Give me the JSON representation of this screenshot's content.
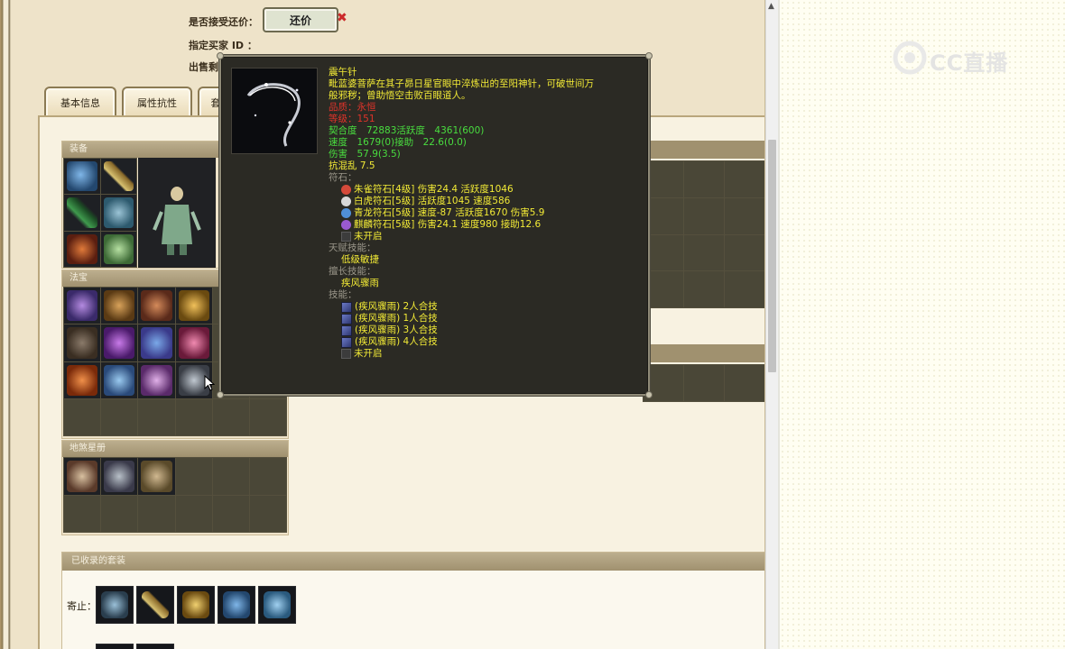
{
  "form": {
    "accept_counter_label": "是否接受还价：",
    "counter_button": "还价",
    "buyer_id_label": "指定买家 ID ：",
    "sale_label_partial": "出售剩"
  },
  "tabs": [
    {
      "label": "基本信息"
    },
    {
      "label": "属性抗性"
    },
    {
      "label": "套"
    }
  ],
  "sections": {
    "equipment": "装备",
    "treasure": "法宝",
    "starbook": "地煞星册",
    "collected_sets": "已收录的套装",
    "set_row_label": "寄止："
  },
  "watermark": "CC直播",
  "tooltip": {
    "name": "震午针",
    "desc_line1": "毗蓝婆菩萨在其子昴日星官眼中淬炼出的至阳神针，可破世间万",
    "desc_line2": "般邪秽；曾助悟空击败百眼道人。",
    "quality": "品质：永恒",
    "level": "等级：151",
    "fit_line": "契合度　72883活跃度　4361(600)",
    "speed_line": "速度　1679(0)接助　22.6(0.0)",
    "damage_line": "伤害　57.9(3.5)",
    "anti_chaos": "抗混乱 7.5",
    "runes_label": "符石：",
    "runes": [
      {
        "text": "朱雀符石[4级] 伤害24.4 活跃度1046",
        "color": "#d44a3a"
      },
      {
        "text": "白虎符石[5级] 活跃度1045 速度586",
        "color": "#d8d8d8"
      },
      {
        "text": "青龙符石[5级] 速度-87 活跃度1670 伤害5.9",
        "color": "#4f8fd8"
      },
      {
        "text": "麒麟符石[5级] 伤害24.1 速度980 接助12.6",
        "color": "#9a5ad0"
      },
      {
        "text": "未开启",
        "color": "#555555"
      }
    ],
    "talent_label": "天赋技能：",
    "talent_value": "低级敏捷",
    "special_label": "擅长技能：",
    "special_value": "疾风骤雨",
    "skills_label": "技能：",
    "skills": [
      "(疾风骤雨) 2人合技",
      "(疾风骤雨) 1人合技",
      "(疾风骤雨) 3人合技",
      "(疾风骤雨) 4人合技",
      "未开启"
    ]
  }
}
